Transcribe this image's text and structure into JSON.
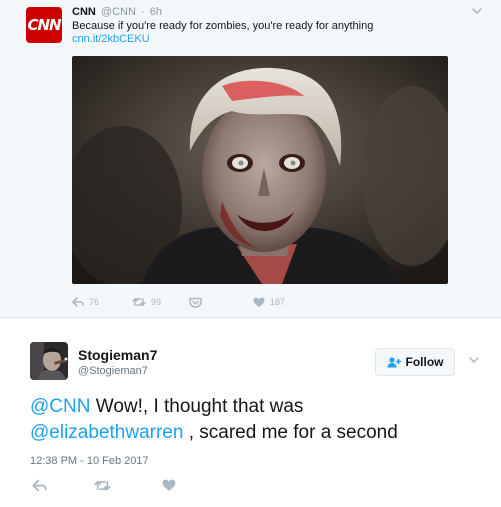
{
  "quoted_tweet": {
    "logo_text": "CNN",
    "name": "CNN",
    "handle": "@CNN",
    "separator": "·",
    "time": "6h",
    "text": "Because if you're ready for zombies, you're ready for anything",
    "link": "cnn.it/2kbCEKU",
    "actions": {
      "reply_count": "76",
      "retweet_count": "99",
      "like_count": "187"
    }
  },
  "reply_tweet": {
    "name": "Stogieman7",
    "handle": "@Stogieman7",
    "follow_label": "Follow",
    "text_parts": {
      "mention_cnn": "@CNN",
      "text_a": " Wow!, I thought that was",
      "mention_warren": "@elizabethwarren",
      "text_b": " , scared me for a second"
    },
    "timestamp": "12:38 PM - 10 Feb 2017"
  },
  "colors": {
    "brand_red": "#cc0000",
    "link_blue": "#1da1f2",
    "muted_grey": "#aab8c2",
    "quoted_background": "#f5f8fa"
  }
}
